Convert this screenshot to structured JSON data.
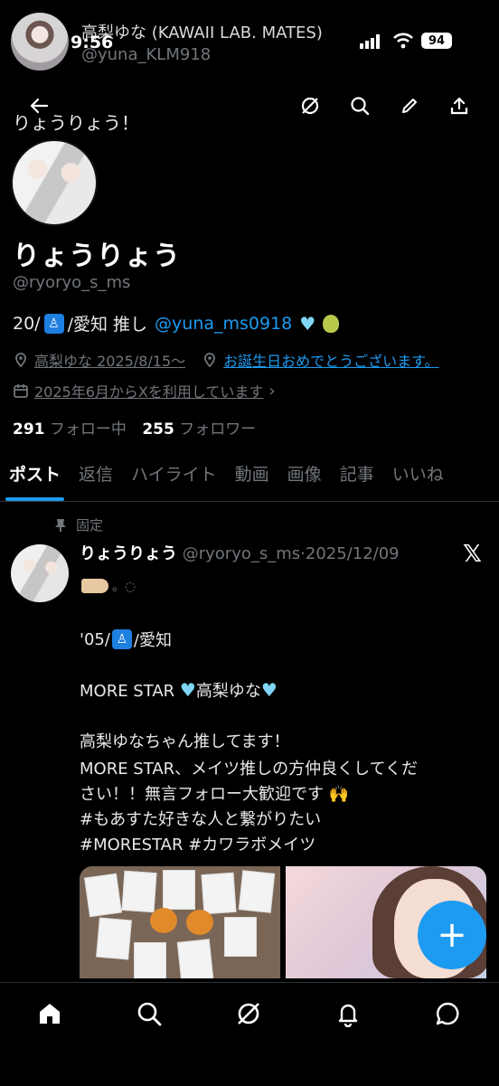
{
  "status_bar": {
    "time": "9:56",
    "battery": "94"
  },
  "sticky_header": {
    "name": "高梨ゆな (KAWAII LAB. MATES)",
    "handle": "@yuna_KLM918"
  },
  "profile": {
    "header_title": "りょうりょう！",
    "display_name": "りょうりょう",
    "handle": "@ryoryo_s_ms",
    "bio": {
      "prefix": "20/",
      "middle": "/愛知 推し",
      "mention": "@yuna_ms0918"
    },
    "affiliation": "高梨ゆな 2025/8/15～",
    "location": "お誕生日おめでとうございます。",
    "joined": "2025年6月からXを利用しています",
    "following_count": "291",
    "following_label": "フォロー中",
    "followers_count": "255",
    "followers_label": "フォロワー"
  },
  "tabs": [
    {
      "label": "ポスト",
      "active": true
    },
    {
      "label": "返信"
    },
    {
      "label": "ハイライト"
    },
    {
      "label": "動画"
    },
    {
      "label": "画像"
    },
    {
      "label": "記事"
    },
    {
      "label": "いいね"
    }
  ],
  "post": {
    "pinned_label": "固定",
    "author_name": "りょうりょう",
    "author_handle": "@ryoryo_s_ms",
    "separator": "·",
    "date": "2025/12/09",
    "tag_suffix": "。◌",
    "line_age": "'05/",
    "line_age_suffix": "/愛知",
    "line_morestar_a": "MORE STAR",
    "line_morestar_b": "高梨ゆな",
    "line_oshi": "高梨ゆなちゃん推してます！",
    "line_request_1": "MORE STAR、メイツ推しの方仲良くしてくだ",
    "line_request_2": "さい！！無言フォロー大歓迎です",
    "hashtag_1": "#もあすた好きな人と繋がりたい",
    "hashtag_2": "#MORESTAR #カワラボメイツ"
  },
  "icons": {
    "back": "arrow-left-icon",
    "grok": "grok-icon",
    "search": "search-icon",
    "edit": "pencil-icon",
    "share": "share-icon",
    "fab": "plus-icon"
  },
  "colors": {
    "accent": "#1d9bf0",
    "muted": "#71767b",
    "background": "#000000"
  }
}
